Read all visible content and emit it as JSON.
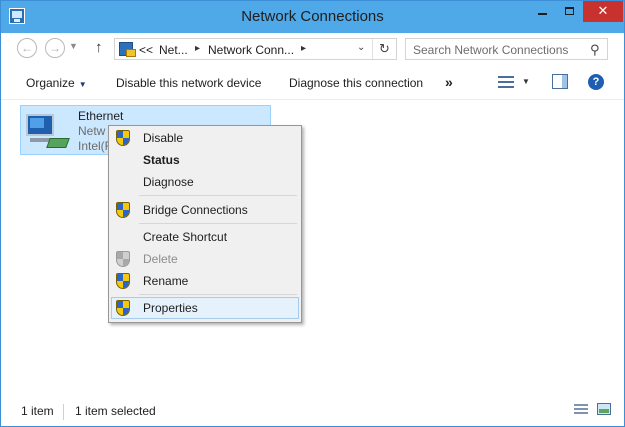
{
  "window": {
    "title": "Network Connections"
  },
  "titlebar": {
    "minimize_glyph": "",
    "maximize_glyph": "",
    "close_glyph": "✕"
  },
  "nav": {
    "back_glyph": "←",
    "forward_glyph": "→",
    "up_glyph": "↑",
    "address": {
      "overflow": "<<",
      "crumbs": [
        "Net...",
        "Network Conn..."
      ],
      "separator": "▸"
    },
    "refresh_glyph": "↻",
    "search": {
      "placeholder": "Search Network Connections"
    }
  },
  "commands": {
    "organize": "Organize",
    "disable": "Disable this network device",
    "diagnose": "Diagnose this connection",
    "more": "»",
    "help_glyph": "?"
  },
  "item": {
    "name": "Ethernet",
    "line2": "Netw",
    "line3": "Intel(R"
  },
  "context_menu": {
    "items": [
      {
        "label": "Disable",
        "shield": true,
        "bold": false,
        "disabled": false
      },
      {
        "label": "Status",
        "shield": false,
        "bold": true,
        "disabled": false
      },
      {
        "label": "Diagnose",
        "shield": false,
        "bold": false,
        "disabled": false
      },
      {
        "label": "Bridge Connections",
        "shield": true,
        "bold": false,
        "disabled": false
      },
      {
        "label": "Create Shortcut",
        "shield": false,
        "bold": false,
        "disabled": false
      },
      {
        "label": "Delete",
        "shield": true,
        "bold": false,
        "disabled": true
      },
      {
        "label": "Rename",
        "shield": true,
        "bold": false,
        "disabled": false
      },
      {
        "label": "Properties",
        "shield": true,
        "bold": false,
        "disabled": false,
        "highlighted": true
      }
    ]
  },
  "status": {
    "count": "1 item",
    "selected": "1 item selected"
  },
  "colors": {
    "titlebar": "#4fa8e8",
    "selection": "#cce8ff",
    "menu_hover": "#e5f1fb"
  }
}
